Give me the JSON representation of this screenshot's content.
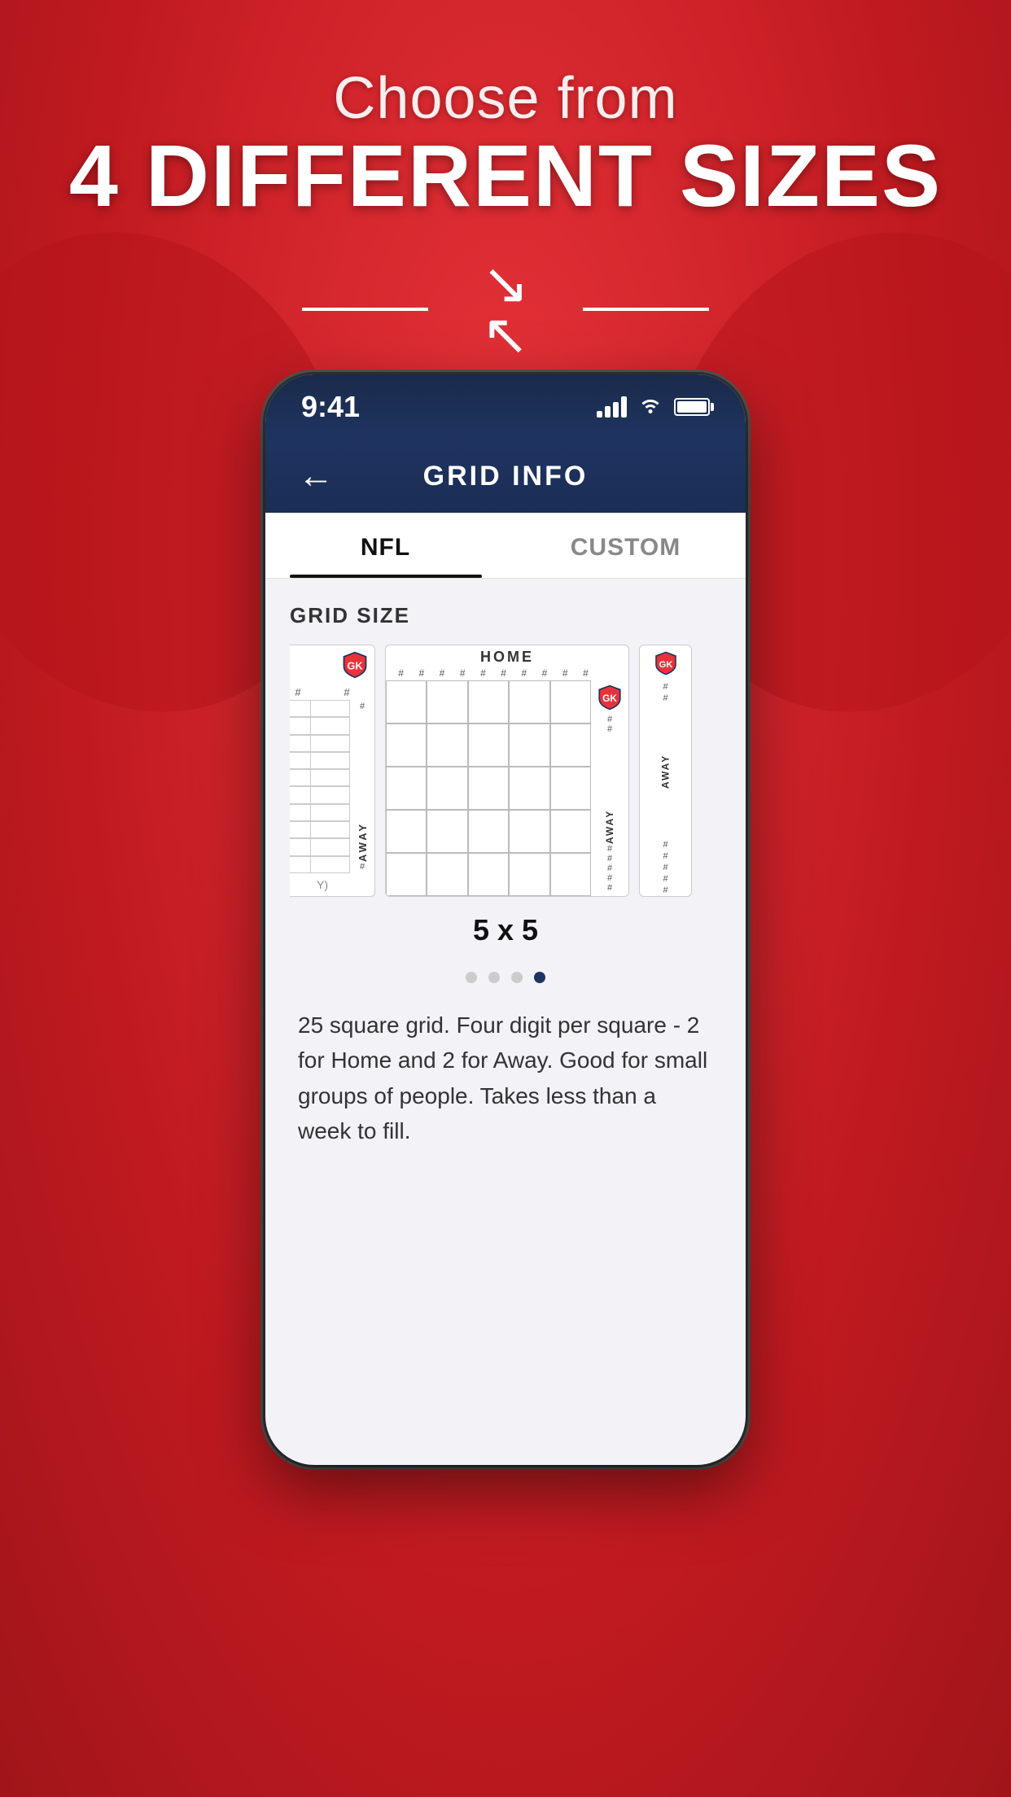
{
  "header": {
    "line1": "Choose from",
    "line2": "4 DIFFERENT SIZES"
  },
  "phone": {
    "statusBar": {
      "time": "9:41",
      "signalBars": [
        1,
        2,
        3,
        4
      ],
      "battery": 100
    },
    "navBar": {
      "backLabel": "←",
      "title": "GRID INFO"
    },
    "tabs": [
      {
        "label": "NFL",
        "active": true
      },
      {
        "label": "CUSTOM",
        "active": false
      }
    ],
    "gridSizeLabel": "GRID SIZE",
    "gridSizeValue": "5 x 5",
    "dots": [
      {
        "active": false
      },
      {
        "active": false
      },
      {
        "active": false
      },
      {
        "active": true
      }
    ],
    "description": "25 square grid. Four digit per square - 2 for Home and 2 for Away. Good for small groups of people. Takes less than a week to fill.",
    "homeLabel": "HOME",
    "awayLabel": "AWAY"
  }
}
